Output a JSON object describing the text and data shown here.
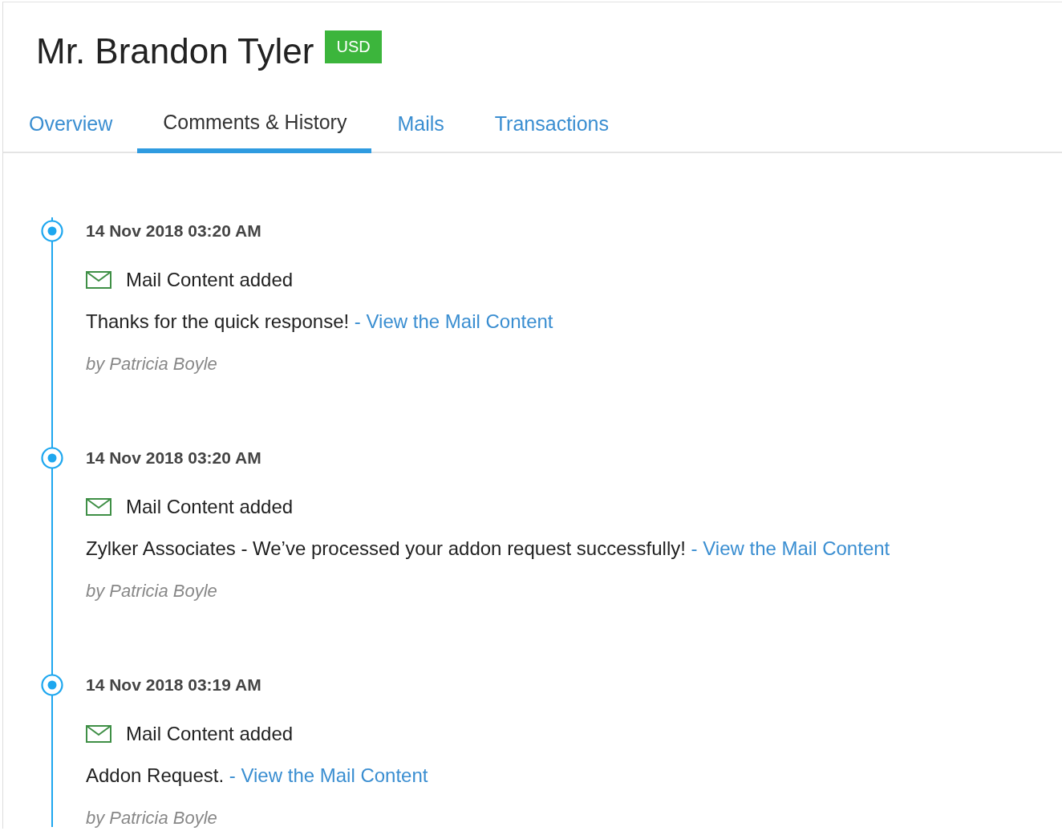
{
  "header": {
    "title": "Mr. Brandon Tyler",
    "currency_badge": "USD"
  },
  "tabs": [
    {
      "label": "Overview",
      "selected": false
    },
    {
      "label": "Comments & History",
      "selected": true
    },
    {
      "label": "Mails",
      "selected": false
    },
    {
      "label": "Transactions",
      "selected": false
    }
  ],
  "timeline": [
    {
      "date": "14 Nov 2018 03:20 AM",
      "event": "Mail Content added",
      "text": "Thanks for the quick response!",
      "link": "- View the Mail Content",
      "author": "by Patricia Boyle"
    },
    {
      "date": "14 Nov 2018 03:20 AM",
      "event": "Mail Content added",
      "text": "Zylker Associates - We’ve processed your addon request successfully!",
      "link": "- View the Mail Content",
      "author": "by Patricia Boyle"
    },
    {
      "date": "14 Nov 2018 03:19 AM",
      "event": "Mail Content added",
      "text": "Addon Request.",
      "link": "- View the Mail Content",
      "author": "by Patricia Boyle"
    }
  ]
}
